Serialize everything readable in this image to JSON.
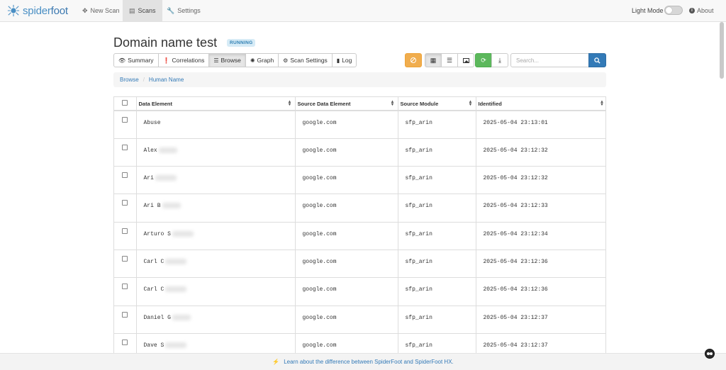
{
  "navbar": {
    "brand_prefix": "spider",
    "brand_suffix": "foot",
    "items": [
      {
        "icon": "✥",
        "label": "New Scan"
      },
      {
        "icon": "▤",
        "label": "Scans"
      },
      {
        "icon": "🔧",
        "label": "Settings"
      }
    ],
    "light_mode_label": "Light Mode",
    "about_label": "About"
  },
  "scan": {
    "title": "Domain name test",
    "status": "RUNNING"
  },
  "tabs": [
    {
      "icon": "👁",
      "label": "Summary"
    },
    {
      "icon": "❗",
      "label": "Correlations"
    },
    {
      "icon": "☰",
      "label": "Browse"
    },
    {
      "icon": "✺",
      "label": "Graph"
    },
    {
      "icon": "⚙",
      "label": "Scan Settings"
    },
    {
      "icon": "▮",
      "label": "Log"
    }
  ],
  "search": {
    "placeholder": "Search..."
  },
  "breadcrumb": {
    "root": "Browse",
    "current": "Human Name"
  },
  "table": {
    "headers": [
      "Data Element",
      "Source Data Element",
      "Source Module",
      "Identified"
    ],
    "rows": [
      {
        "data": "Abuse",
        "source": "google.com",
        "module": "sfp_arin",
        "identified": "2025-05-04 23:13:01"
      },
      {
        "data": "Alex",
        "source": "google.com",
        "module": "sfp_arin",
        "identified": "2025-05-04 23:12:32"
      },
      {
        "data": "Ari",
        "source": "google.com",
        "module": "sfp_arin",
        "identified": "2025-05-04 23:12:32"
      },
      {
        "data": "Ari B",
        "source": "google.com",
        "module": "sfp_arin",
        "identified": "2025-05-04 23:12:33"
      },
      {
        "data": "Arturo S",
        "source": "google.com",
        "module": "sfp_arin",
        "identified": "2025-05-04 23:12:34"
      },
      {
        "data": "Carl C",
        "source": "google.com",
        "module": "sfp_arin",
        "identified": "2025-05-04 23:12:36"
      },
      {
        "data": "Carl C",
        "source": "google.com",
        "module": "sfp_arin",
        "identified": "2025-05-04 23:12:36"
      },
      {
        "data": "Daniel G",
        "source": "google.com",
        "module": "sfp_arin",
        "identified": "2025-05-04 23:12:37"
      },
      {
        "data": "Dave S",
        "source": "google.com",
        "module": "sfp_arin",
        "identified": "2025-05-04 23:12:37"
      }
    ]
  },
  "footer": {
    "link_text": "Learn about the difference between SpiderFoot and SpiderFoot HX."
  },
  "colors": {
    "brand": "#4a8fc4",
    "running_badge": "#d6ebf6",
    "warning": "#f0ad4e",
    "success": "#5cb85c",
    "primary": "#337ab7"
  }
}
